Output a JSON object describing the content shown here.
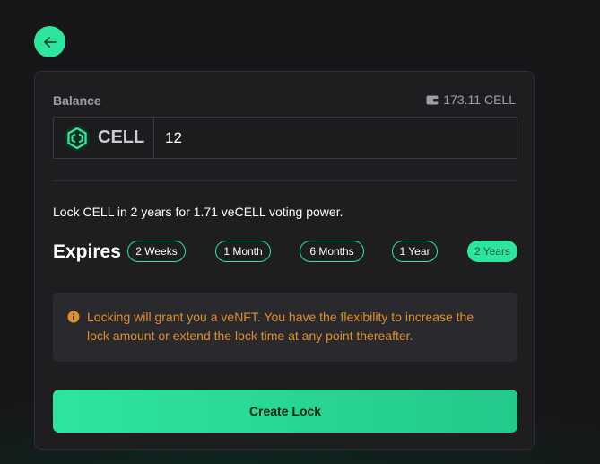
{
  "header": {
    "back_icon": "arrow-left-icon"
  },
  "balance": {
    "label": "Balance",
    "value": "173.11 CELL",
    "icon": "wallet-icon"
  },
  "token": {
    "name": "CELL",
    "icon": "cell-logo-icon"
  },
  "amount": {
    "value": "12"
  },
  "summary": {
    "text": "Lock CELL in 2 years for 1.71 veCELL voting power."
  },
  "expires": {
    "label": "Expires",
    "options": [
      "2 Weeks",
      "1 Month",
      "6 Months",
      "1 Year",
      "2 Years"
    ],
    "selected": "2 Years"
  },
  "info": {
    "icon": "info-icon",
    "line1": "Locking will grant you a veNFT. You have the flexibility to increase the",
    "line2": "lock amount or extend the lock time at any point thereafter."
  },
  "actions": {
    "create_label": "Create Lock"
  },
  "colors": {
    "accent": "#2ee59d",
    "warning": "#e0902a",
    "card": "#1e1e21"
  }
}
